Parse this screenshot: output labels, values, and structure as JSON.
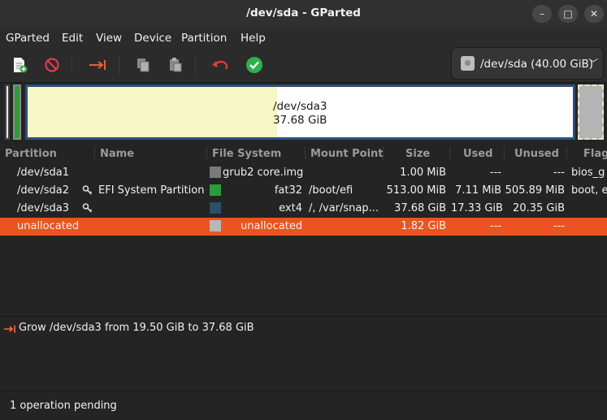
{
  "window": {
    "title": "/dev/sda - GParted"
  },
  "menu": [
    "GParted",
    "Edit",
    "View",
    "Device",
    "Partition",
    "Help"
  ],
  "toolbar": {
    "device": "/dev/sda (40.00 GiB)"
  },
  "disk_map": {
    "selected_label": "/dev/sda3",
    "selected_size": "37.68 GiB"
  },
  "table": {
    "headers": [
      "Partition",
      "Name",
      "File System",
      "Mount Point",
      "Size",
      "Used",
      "Unused",
      "Flag"
    ],
    "rows": [
      {
        "partition": "/dev/sda1",
        "name": "",
        "fs": "grub2 core.img",
        "mount": "",
        "size": "1.00 MiB",
        "used": "---",
        "unused": "---",
        "flags": "bios_g",
        "color": "#7a7a7a"
      },
      {
        "partition": "/dev/sda2",
        "name": "EFI System Partition",
        "fs": "fat32",
        "mount": "/boot/efi",
        "size": "513.00 MiB",
        "used": "7.11 MiB",
        "unused": "505.89 MiB",
        "flags": "boot, e",
        "color": "#2f9a3c"
      },
      {
        "partition": "/dev/sda3",
        "name": "",
        "fs": "ext4",
        "mount": "/, /var/snap...",
        "size": "37.68 GiB",
        "used": "17.33 GiB",
        "unused": "20.35 GiB",
        "flags": "",
        "color": "#2c4f6c"
      },
      {
        "partition": "unallocated",
        "name": "",
        "fs": "unallocated",
        "mount": "",
        "size": "1.82 GiB",
        "used": "---",
        "unused": "---",
        "flags": "",
        "color": "#b8b8b8",
        "selected": true
      }
    ]
  },
  "pending": {
    "operations": [
      "Grow /dev/sda3 from 19.50 GiB to 37.68 GiB"
    ],
    "status": "1 operation pending"
  },
  "colors": {
    "accent": "#e95420",
    "ext4": "#2c4f6c",
    "fat32": "#2f9a3c",
    "used": "#f7f7c5"
  }
}
